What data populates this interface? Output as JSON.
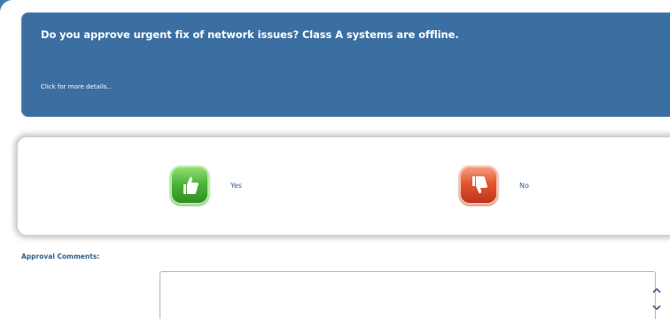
{
  "question": {
    "title": "Do you approve urgent fix of network issues? Class A systems are offline.",
    "details_link": "Click for more details..."
  },
  "choices": [
    {
      "label": "Yes",
      "icon": "thumbs-up-icon",
      "color": "#4cb63a"
    },
    {
      "label": "No",
      "icon": "thumbs-down-icon",
      "color": "#e4572f"
    }
  ],
  "comments": {
    "label": "Approval Comments:",
    "value": ""
  },
  "colors": {
    "header": "#3b6ea1",
    "label_text": "#2f5e8f"
  }
}
